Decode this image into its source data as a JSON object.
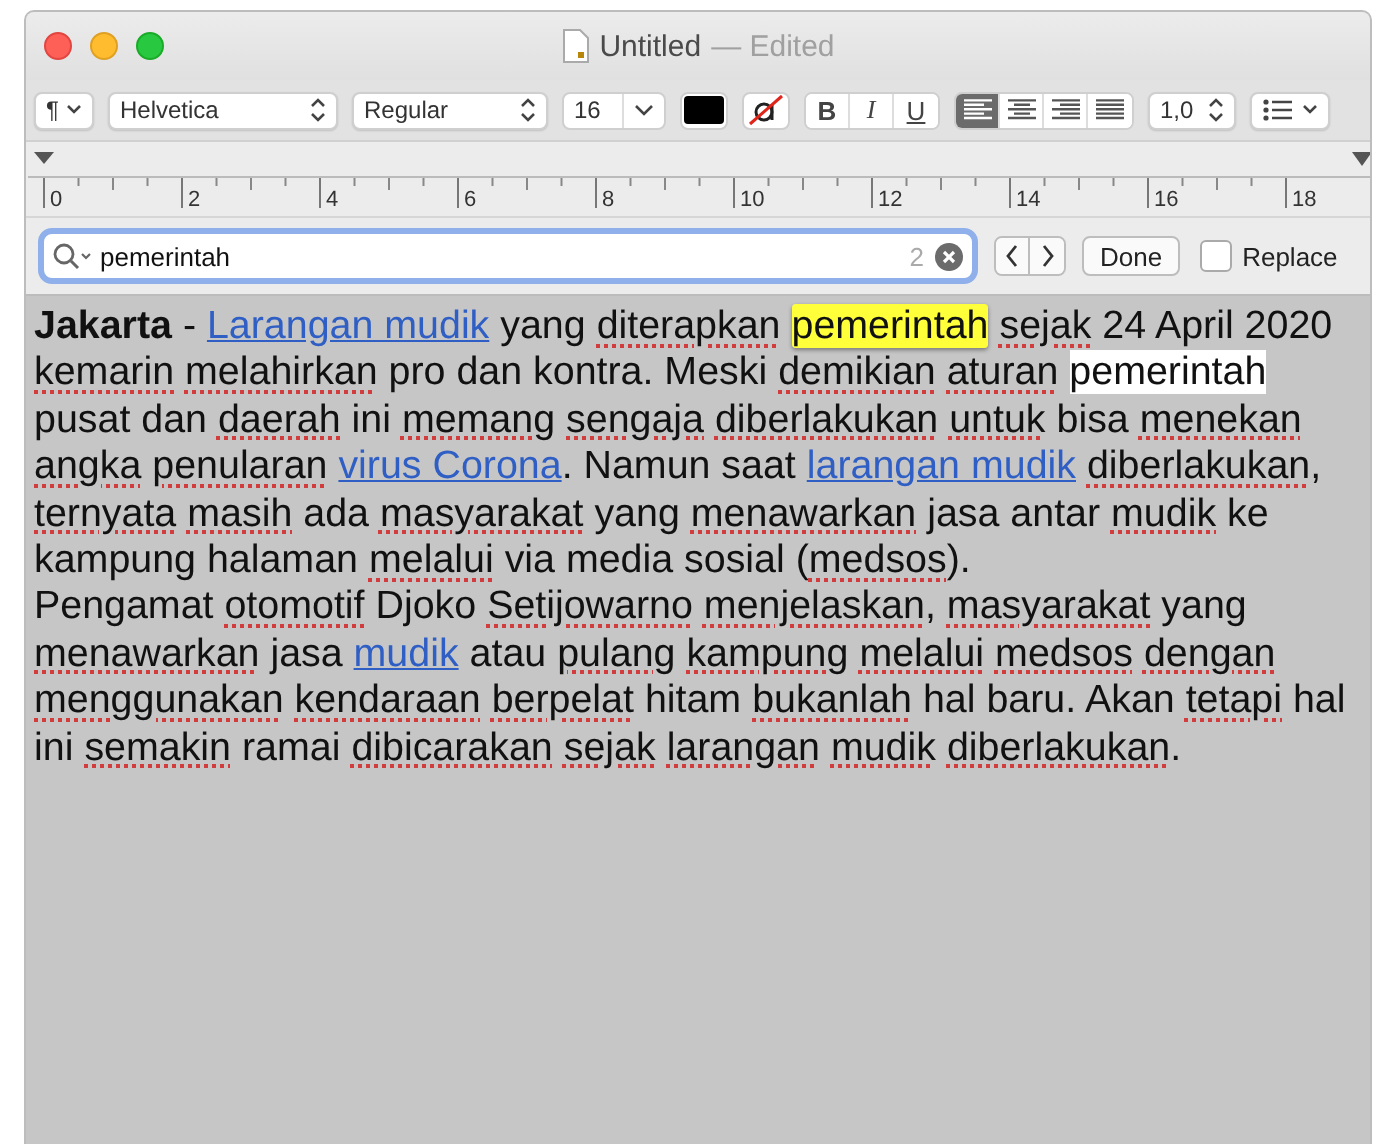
{
  "window": {
    "title": "Untitled",
    "status": "— Edited"
  },
  "toolbar": {
    "paragraph_style": "¶",
    "font_family": "Helvetica",
    "font_style": "Regular",
    "font_size": "16",
    "bold": {
      "label": "B",
      "on": false
    },
    "italic": {
      "label": "I",
      "on": false
    },
    "underline": {
      "label": "U",
      "on": false
    },
    "alignments": [
      {
        "kind": "left",
        "selected": true
      },
      {
        "kind": "center",
        "selected": false
      },
      {
        "kind": "right",
        "selected": false
      },
      {
        "kind": "justify",
        "selected": false
      }
    ],
    "line_spacing": "1,0"
  },
  "ruler": [
    "0",
    "2",
    "4",
    "6",
    "8",
    "10",
    "12",
    "14",
    "16",
    "18"
  ],
  "find_bar": {
    "value": "pemerintah",
    "count": "2",
    "done": "Done",
    "replace": {
      "label": "Replace",
      "checked": false
    }
  },
  "document": [
    [
      {
        "text": "Jakarta",
        "kind": "bold"
      },
      {
        "text": " - ",
        "kind": "text"
      },
      {
        "text": "Larangan mudik",
        "kind": "link"
      },
      {
        "text": " yang",
        "kind": "text"
      },
      {
        "text": " diterapkan ",
        "kind": "spell"
      },
      {
        "text": "pemerintah",
        "kind": "current-match"
      },
      {
        "text": " sejak",
        "kind": "spell"
      },
      {
        "text": " 24 April 2020",
        "kind": "text"
      },
      {
        "text": " kemarin",
        "kind": "spell"
      },
      {
        "text": " melahirkan",
        "kind": "spell"
      },
      {
        "text": " pro dan kontra. Meski",
        "kind": "text"
      },
      {
        "text": " demikian",
        "kind": "spell"
      },
      {
        "text": " aturan ",
        "kind": "spell"
      },
      {
        "text": "pemerintah",
        "kind": "match"
      },
      {
        "text": " pusat dan",
        "kind": "text"
      },
      {
        "text": " daerah",
        "kind": "spell"
      },
      {
        "text": " ini",
        "kind": "text"
      },
      {
        "text": " memang",
        "kind": "spell"
      },
      {
        "text": " sengaja",
        "kind": "spell"
      },
      {
        "text": " diberlakukan",
        "kind": "spell"
      },
      {
        "text": " untuk",
        "kind": "spell"
      },
      {
        "text": " bisa",
        "kind": "text"
      },
      {
        "text": " menekan",
        "kind": "spell"
      },
      {
        "text": " angka",
        "kind": "spell"
      },
      {
        "text": " penularan ",
        "kind": "spell"
      },
      {
        "text": "virus Corona",
        "kind": "link"
      },
      {
        "text": ". Namun saat ",
        "kind": "text"
      },
      {
        "text": "larangan mudik",
        "kind": "link"
      },
      {
        "text": " diberlakukan",
        "kind": "spell"
      },
      {
        "text": ",",
        "kind": "text"
      },
      {
        "text": " ternyata",
        "kind": "spell"
      },
      {
        "text": " masih",
        "kind": "spell"
      },
      {
        "text": " ada",
        "kind": "text"
      },
      {
        "text": " masyarakat",
        "kind": "spell"
      },
      {
        "text": " yang",
        "kind": "text"
      },
      {
        "text": " menawarkan",
        "kind": "spell"
      },
      {
        "text": " jasa antar",
        "kind": "text"
      },
      {
        "text": " mudik",
        "kind": "spell"
      },
      {
        "text": " ke kampung halaman",
        "kind": "text"
      },
      {
        "text": " melalui",
        "kind": "spell"
      },
      {
        "text": " via media sosial (",
        "kind": "text"
      },
      {
        "text": "medsos",
        "kind": "spell"
      },
      {
        "text": ").",
        "kind": "text"
      }
    ],
    [
      {
        "text": "Pengamat",
        "kind": "text"
      },
      {
        "text": " otomotif",
        "kind": "spell"
      },
      {
        "text": " Djoko",
        "kind": "text"
      },
      {
        "text": " Setijowarno",
        "kind": "spell"
      },
      {
        "text": " menjelaskan",
        "kind": "spell"
      },
      {
        "text": ",",
        "kind": "text"
      },
      {
        "text": " masyarakat",
        "kind": "spell"
      },
      {
        "text": " yang",
        "kind": "text"
      },
      {
        "text": " menawarkan",
        "kind": "spell"
      },
      {
        "text": " jasa ",
        "kind": "text"
      },
      {
        "text": "mudik",
        "kind": "link"
      },
      {
        "text": " atau",
        "kind": "text"
      },
      {
        "text": " pulang",
        "kind": "spell"
      },
      {
        "text": " kampung",
        "kind": "spell"
      },
      {
        "text": " melalui",
        "kind": "spell"
      },
      {
        "text": " medsos",
        "kind": "spell"
      },
      {
        "text": " dengan",
        "kind": "spell"
      },
      {
        "text": " menggunakan",
        "kind": "spell"
      },
      {
        "text": " kendaraan",
        "kind": "spell"
      },
      {
        "text": " berpelat",
        "kind": "spell"
      },
      {
        "text": " hitam",
        "kind": "text"
      },
      {
        "text": " bukanlah",
        "kind": "spell"
      },
      {
        "text": " hal baru. Akan",
        "kind": "text"
      },
      {
        "text": " tetapi",
        "kind": "spell"
      },
      {
        "text": " hal ini",
        "kind": "text"
      },
      {
        "text": " semakin",
        "kind": "spell"
      },
      {
        "text": " ramai",
        "kind": "text"
      },
      {
        "text": " dibicarakan",
        "kind": "spell"
      },
      {
        "text": " sejak",
        "kind": "spell"
      },
      {
        "text": " larangan",
        "kind": "spell"
      },
      {
        "text": " mudik",
        "kind": "spell"
      },
      {
        "text": " diberlakukan",
        "kind": "spell"
      },
      {
        "text": ".",
        "kind": "text"
      }
    ]
  ]
}
